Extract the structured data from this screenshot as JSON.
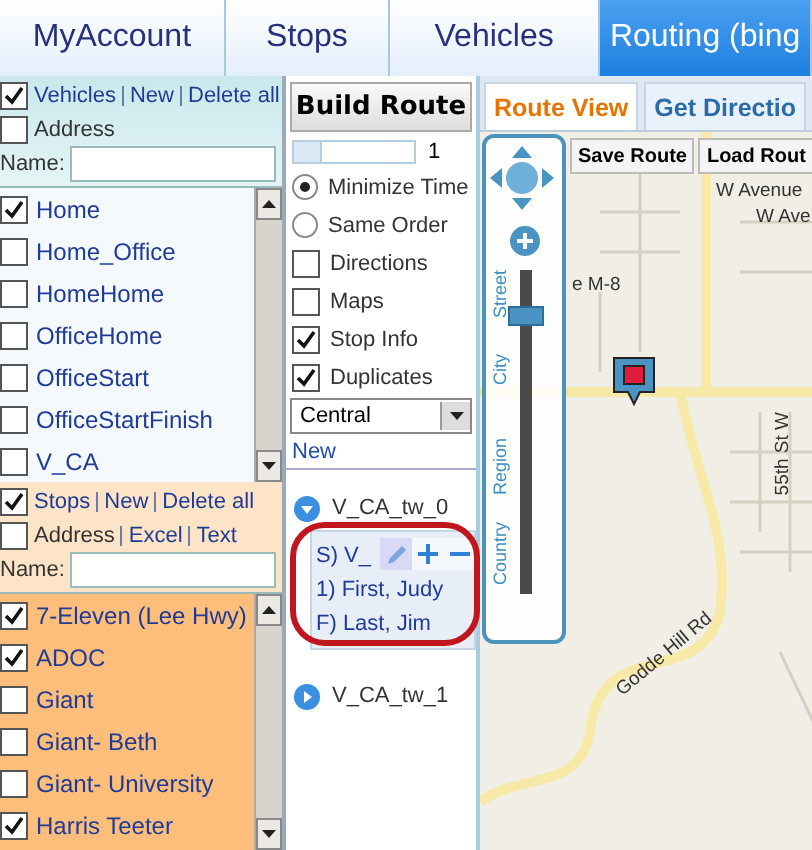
{
  "nav_tabs": [
    {
      "label": "MyAccount",
      "selected": false
    },
    {
      "label": "Stops",
      "selected": false
    },
    {
      "label": "Vehicles",
      "selected": false
    },
    {
      "label": "Routing (bing",
      "selected": true
    }
  ],
  "vehicles_panel": {
    "header_checked": true,
    "links": [
      "Vehicles",
      "New",
      "Delete all"
    ],
    "address_checked": false,
    "address_links": [
      "Address"
    ],
    "name_label": "Name:",
    "items": [
      {
        "label": "Home",
        "checked": true
      },
      {
        "label": "Home_Office",
        "checked": false
      },
      {
        "label": "HomeHome",
        "checked": false
      },
      {
        "label": "OfficeHome",
        "checked": false
      },
      {
        "label": "OfficeStart",
        "checked": false
      },
      {
        "label": "OfficeStartFinish",
        "checked": false
      },
      {
        "label": "V_CA",
        "checked": false
      }
    ]
  },
  "stops_panel": {
    "header_checked": true,
    "links": [
      "Stops",
      "New",
      "Delete all"
    ],
    "address_checked": false,
    "address_links": [
      "Address",
      "Excel",
      "Text"
    ],
    "name_label": "Name:",
    "items": [
      {
        "label": "7-Eleven (Lee Hwy)",
        "checked": true
      },
      {
        "label": "ADOC",
        "checked": true
      },
      {
        "label": "Giant",
        "checked": false
      },
      {
        "label": "Giant- Beth",
        "checked": false
      },
      {
        "label": "Giant- University",
        "checked": false
      },
      {
        "label": "Harris Teeter",
        "checked": true
      }
    ]
  },
  "build_panel": {
    "button": "Build Route",
    "slider": {
      "level": 0.22,
      "reading": "1"
    },
    "options": [
      {
        "kind": "radio",
        "label": "Minimize Time",
        "selected": true
      },
      {
        "kind": "radio",
        "label": "Same Order",
        "selected": false
      },
      {
        "kind": "checkbox",
        "label": "Directions",
        "checked": false
      },
      {
        "kind": "checkbox",
        "label": "Maps",
        "checked": false
      },
      {
        "kind": "checkbox",
        "label": "Stop Info",
        "checked": true
      },
      {
        "kind": "checkbox",
        "label": "Duplicates",
        "checked": true
      }
    ],
    "dropdown": {
      "value": "Central"
    },
    "new_link": "New",
    "routes": [
      {
        "label": "V_CA_tw_0",
        "expanded": true,
        "children": [
          {
            "label": "S) V_"
          },
          {
            "label": "1) First, Judy"
          },
          {
            "label": "F) Last, Jim"
          }
        ]
      },
      {
        "label": "V_CA_tw_1",
        "expanded": false
      }
    ]
  },
  "map": {
    "tabs": [
      {
        "label": "Route View",
        "selected": true
      },
      {
        "label": "Get Directio",
        "selected": false
      }
    ],
    "buttons": [
      "Save Route",
      "Load Rout"
    ],
    "zoom_labels": [
      "Street",
      "City",
      "Region",
      "Country"
    ],
    "zoom": {
      "level": 0.88
    },
    "labels": [
      {
        "text": "W Avenue",
        "kind": "street"
      },
      {
        "text": "W Ave",
        "kind": "street"
      },
      {
        "text": "e M-8",
        "kind": "street"
      },
      {
        "text": "55th St W",
        "kind": "vertical"
      },
      {
        "text": "Godde Hill Rd",
        "kind": "angled"
      }
    ]
  }
}
